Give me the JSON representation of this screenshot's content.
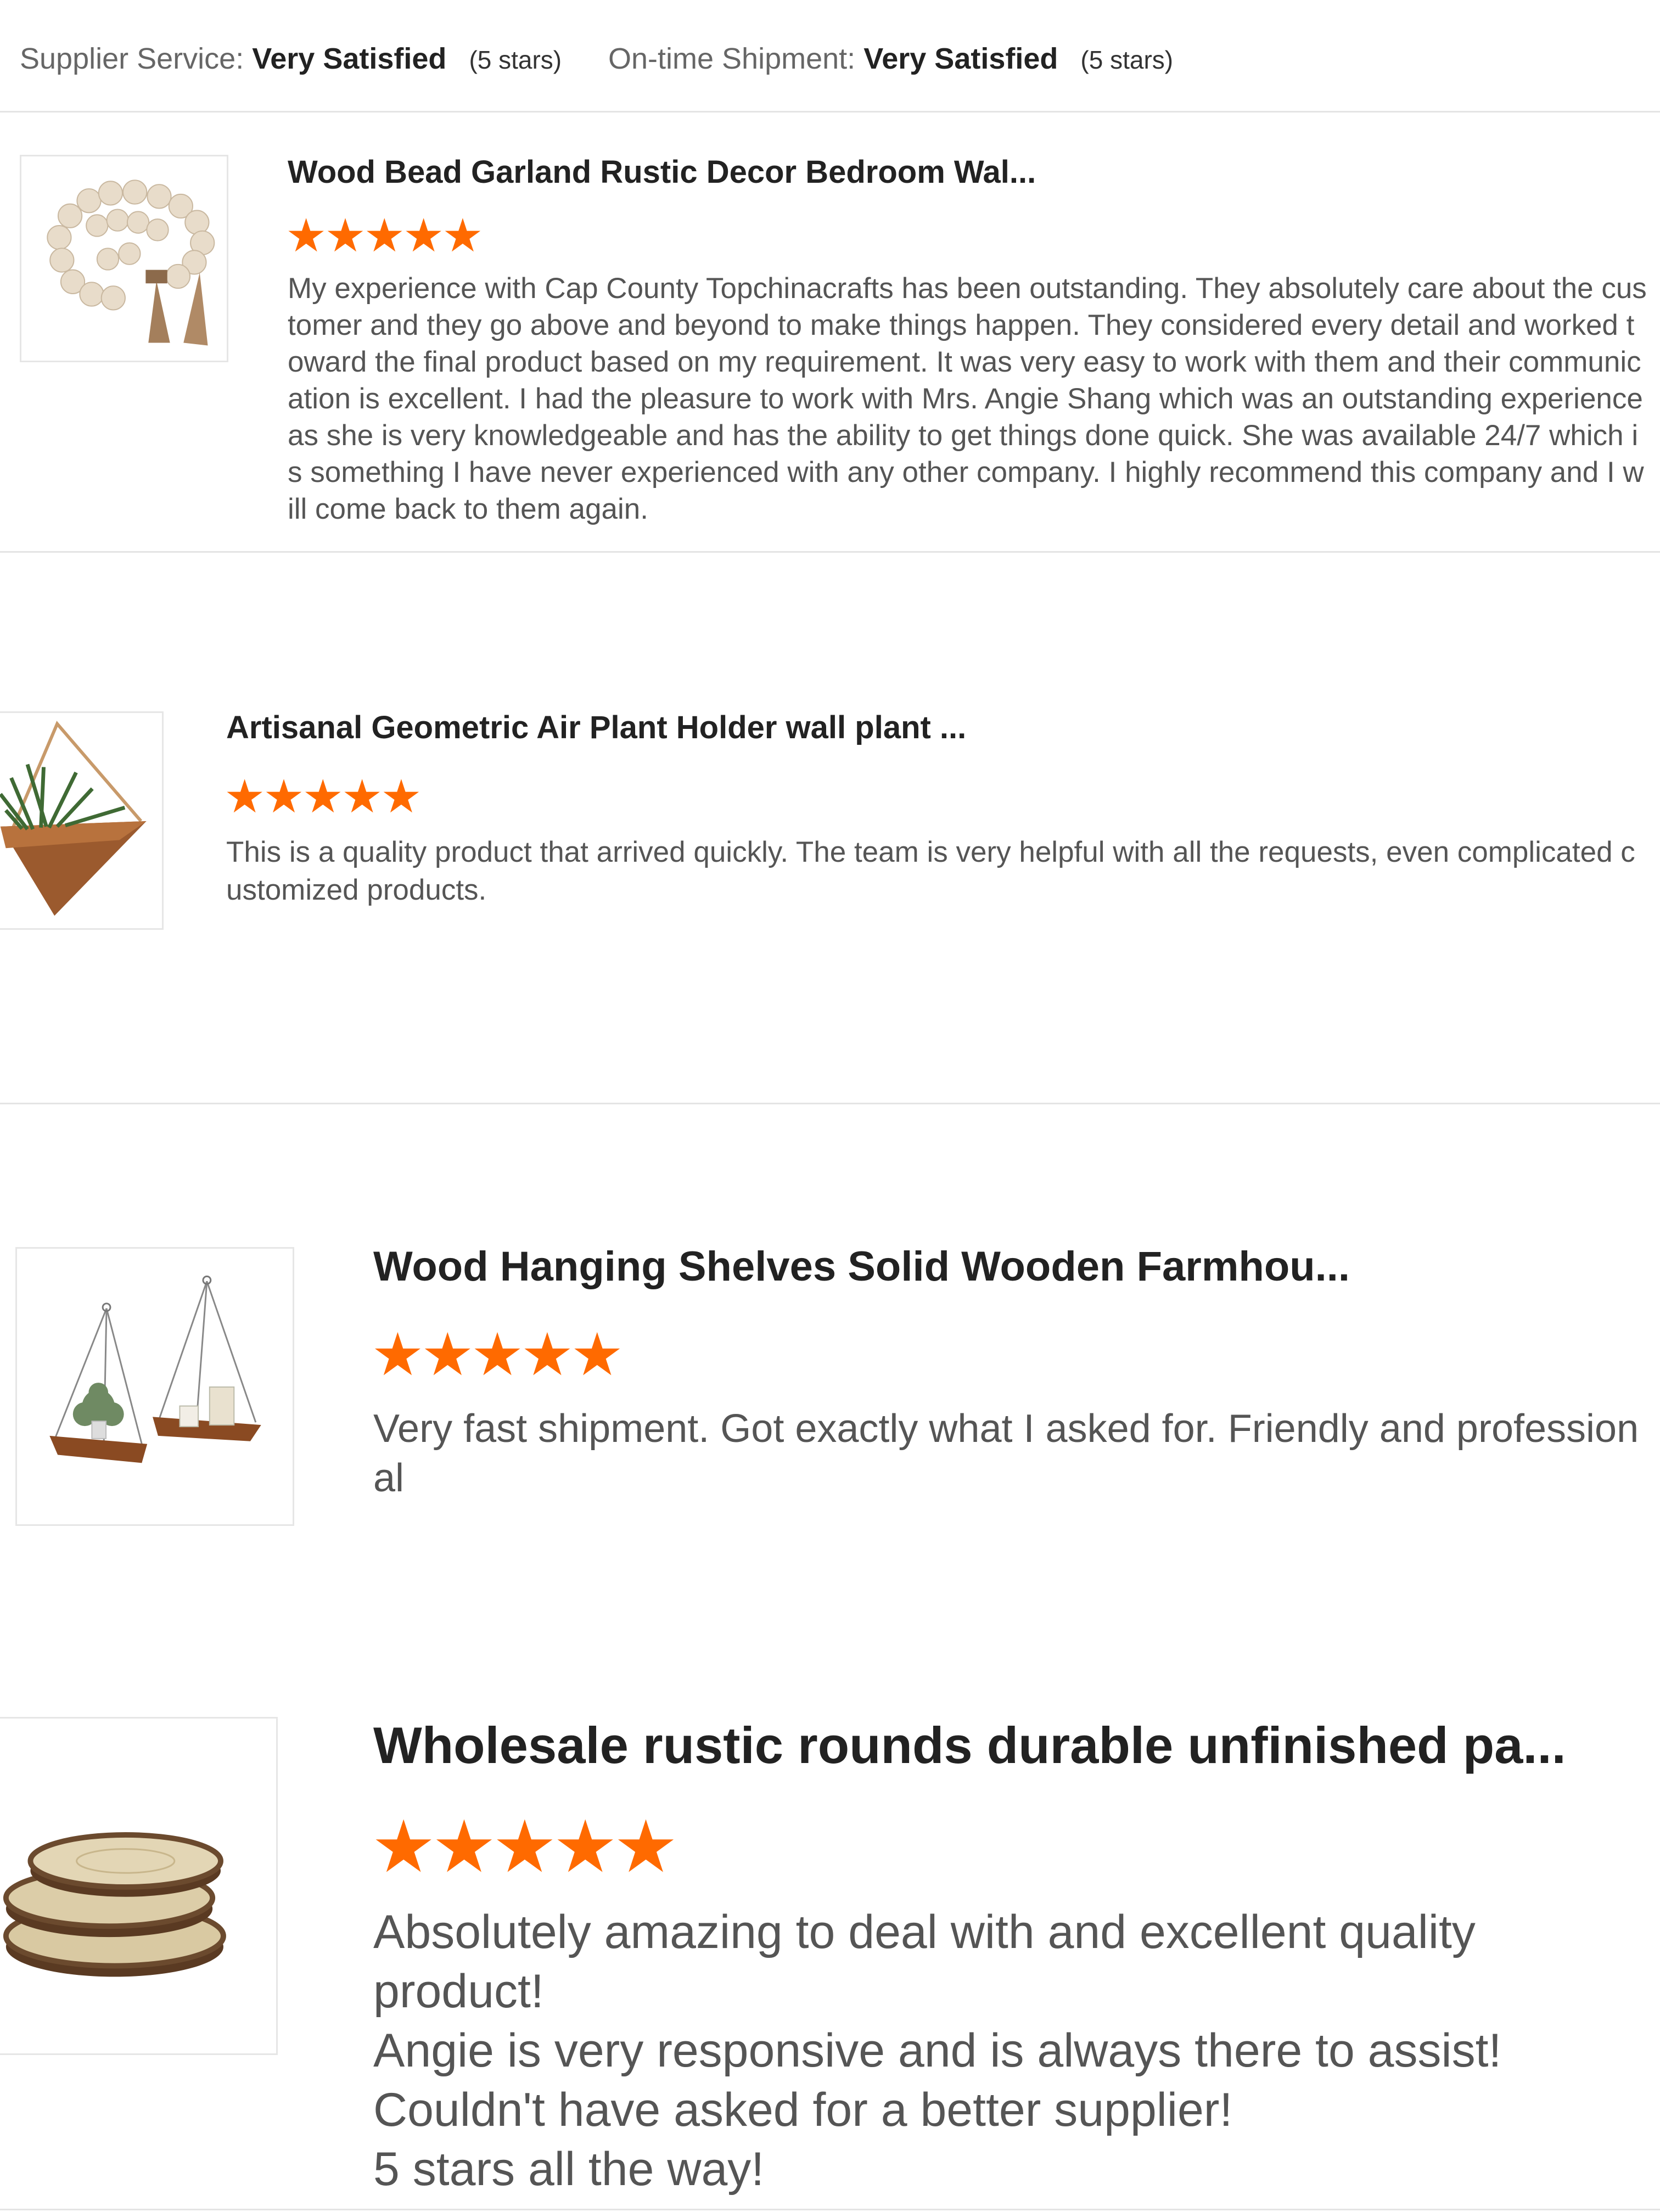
{
  "summary": {
    "supplier_service_label": "Supplier Service:",
    "supplier_service_value": "Very Satisfied",
    "supplier_service_stars": "(5 stars)",
    "shipment_label": "On-time Shipment:",
    "shipment_value": "Very Satisfied",
    "shipment_stars": "(5 stars)"
  },
  "reviews": [
    {
      "product_title": "Wood Bead Garland Rustic Decor Bedroom Wal...",
      "rating": 5,
      "text": "My experience with Cap County Topchinacrafts has been outstanding. They absolutely care about the customer and they go above and beyond to make things happen. They considered every detail and worked toward the final product based on my requirement. It was very easy to work with them and their communication is excellent.  I had the pleasure to work with Mrs. Angie Shang which was an outstanding experience as she is very knowledgeable and has the ability to get things done quick. She was available 24/7 which is something I have never experienced with any other company. I highly recommend this company and I will come back to them again.",
      "image": "wood-bead-garland"
    },
    {
      "product_title": "Artisanal Geometric Air Plant Holder wall plant ...",
      "rating": 5,
      "text": "This is a quality product that arrived quickly. The team is very helpful with all the requests, even complicated customized products.",
      "image": "geometric-air-plant-holder"
    },
    {
      "product_title": "Wood Hanging Shelves Solid Wooden Farmhou...",
      "rating": 5,
      "text": "Very fast shipment. Got exactly what I asked for. Friendly and professional",
      "image": "wood-hanging-shelves"
    },
    {
      "product_title": "Wholesale rustic rounds durable unfinished pa...",
      "rating": 5,
      "text": "Absolutely amazing to deal with and excellent quality product!\nAngie is very responsive and is always there to assist!\nCouldn't have asked for a better supplier!\n5 stars all the way!",
      "image": "rustic-wood-rounds"
    }
  ],
  "colors": {
    "star": "#ff6a00",
    "divider": "#e4e4e4",
    "title": "#222222",
    "body": "#555555"
  }
}
